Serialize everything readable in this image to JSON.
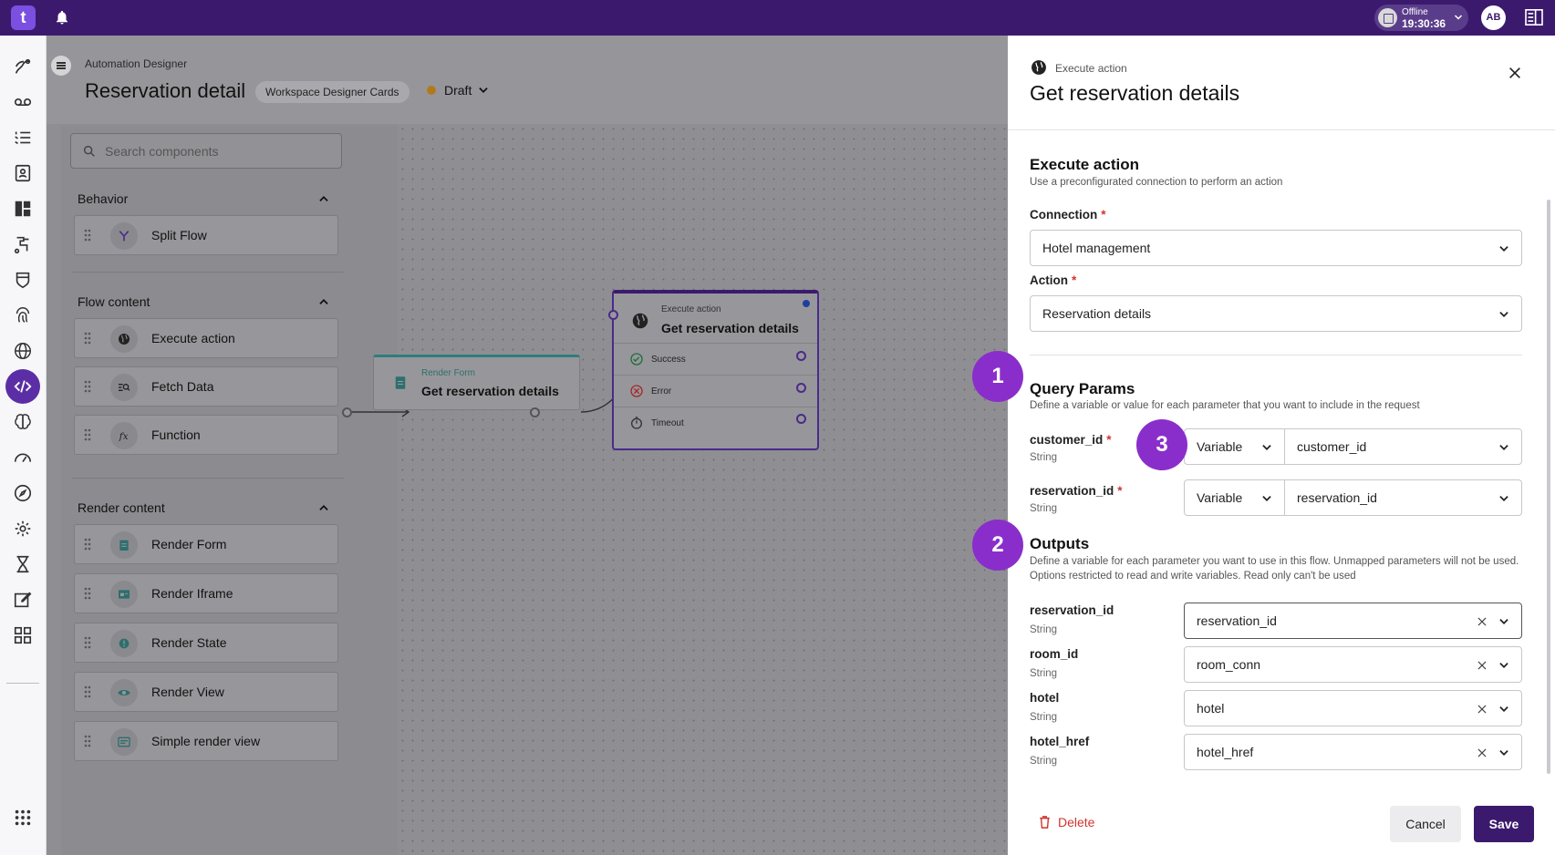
{
  "topbar": {
    "logo_text": "t",
    "status_label": "Offline",
    "status_time": "19:30:36",
    "avatar_initials": "AB"
  },
  "nav": {
    "items": [
      "routing-icon",
      "voicemail-icon",
      "list-icon",
      "contacts-icon",
      "dashboard-icon",
      "flow-icon",
      "shield-icon",
      "fingerprint-icon",
      "globe-icon",
      "code-icon",
      "brain-icon",
      "speed-icon",
      "compass-icon",
      "settings-icon",
      "dna-icon",
      "edit-icon",
      "widgets-icon",
      "apps-icon"
    ],
    "active": "code-icon"
  },
  "header": {
    "breadcrumb": "Automation Designer",
    "title": "Reservation detail",
    "chip": "Workspace Designer Cards",
    "status": "Draft"
  },
  "palette": {
    "search_placeholder": "Search components",
    "sections": [
      {
        "title": "Behavior",
        "items": [
          "Split Flow"
        ]
      },
      {
        "title": "Flow content",
        "items": [
          "Execute action",
          "Fetch Data",
          "Function"
        ]
      },
      {
        "title": "Render content",
        "items": [
          "Render Form",
          "Render Iframe",
          "Render State",
          "Render View",
          "Simple render view"
        ]
      }
    ]
  },
  "canvas": {
    "render_node": {
      "type": "Render Form",
      "title": "Get reservation details"
    },
    "exec_node": {
      "type": "Execute action",
      "title": "Get reservation details",
      "outcomes": [
        "Success",
        "Error",
        "Timeout"
      ]
    }
  },
  "drawer": {
    "kind": "Execute action",
    "title": "Get reservation details",
    "section_title": "Execute action",
    "section_desc": "Use a preconfigurated connection to perform an action",
    "connection_label": "Connection",
    "connection_value": "Hotel management",
    "action_label": "Action",
    "action_value": "Reservation details",
    "query": {
      "title": "Query Params",
      "desc": "Define a variable or value for each parameter that you want to include in the request",
      "params": [
        {
          "name": "customer_id",
          "type": "String",
          "mode": "Variable",
          "value": "customer_id"
        },
        {
          "name": "reservation_id",
          "type": "String",
          "mode": "Variable",
          "value": "reservation_id"
        }
      ]
    },
    "outputs": {
      "title": "Outputs",
      "desc": "Define a variable for each parameter you want to use in this flow. Unmapped parameters will not be used. Options restricted to read and write variables. Read only can't be used",
      "params": [
        {
          "name": "reservation_id",
          "type": "String",
          "value": "reservation_id"
        },
        {
          "name": "room_id",
          "type": "String",
          "value": "room_conn"
        },
        {
          "name": "hotel",
          "type": "String",
          "value": "hotel"
        },
        {
          "name": "hotel_href",
          "type": "String",
          "value": "hotel_href"
        }
      ]
    },
    "delete_label": "Delete",
    "cancel_label": "Cancel",
    "save_label": "Save"
  },
  "callouts": [
    "1",
    "2",
    "3"
  ],
  "colors": {
    "brand": "#3b1a6e",
    "accent": "#8a2ecb",
    "danger": "#d0342c"
  }
}
